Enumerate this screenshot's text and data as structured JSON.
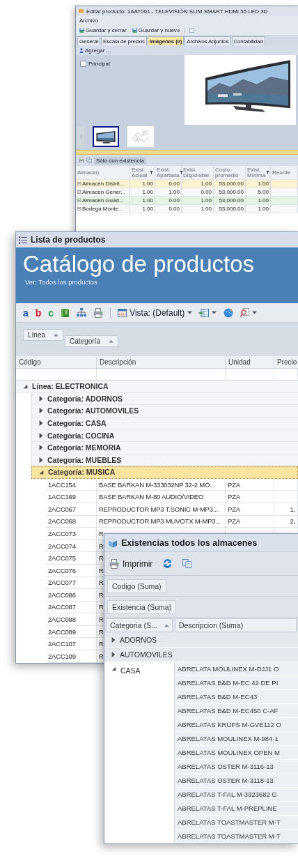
{
  "editor_window": {
    "title": "Editar producto: 1AAT001 - TELEVISIÓN SLIM SMART HDMI 55 LED 3D",
    "menu": [
      "Archivo"
    ],
    "toolbar": [
      "Guardar y cerrar",
      "Guardar y nuevo"
    ],
    "tabs": [
      {
        "label": "General",
        "selected": false
      },
      {
        "label": "Escala de precios",
        "selected": false
      },
      {
        "label": "Imágenes (2)",
        "selected": true
      },
      {
        "label": "Archivos Adjuntos",
        "selected": false
      },
      {
        "label": "Contabilidad",
        "selected": false
      }
    ],
    "add_button": "Agregar ...",
    "principal_checkbox": {
      "label": "Principal",
      "checked": false
    },
    "image": {
      "kind": "picture"
    },
    "thumbnails": [
      {
        "selected": true
      },
      {
        "selected": false
      }
    ],
    "stock_grid": {
      "toggle": {
        "label": "Sólo con existencia",
        "on": true
      },
      "columns": [
        {
          "label": "Almacén",
          "filter": false
        },
        {
          "label": "Exist. Actual",
          "filter": true
        },
        {
          "label": "Exist. Apartada",
          "filter": true
        },
        {
          "label": "Exist. Disponible",
          "filter": false
        },
        {
          "label": "Costo promedio",
          "filter": false
        },
        {
          "label": "Exist. Mínima",
          "filter": true
        },
        {
          "label": "Reorde",
          "filter": false
        }
      ],
      "rows": [
        {
          "cells": [
            "Almacén Distrit...",
            "1.00",
            "0.00",
            "1.00",
            "53,000.00",
            "1.00"
          ],
          "selected": true,
          "highlighted": false
        },
        {
          "cells": [
            "Almacen Gener...",
            "1.00",
            "1.00",
            "0.00",
            "53,000.00",
            "5.00"
          ],
          "selected": false,
          "highlighted": false
        },
        {
          "cells": [
            "Almacen Guad...",
            "1.00",
            "0.00",
            "1.00",
            "53,000.00",
            "1.00"
          ],
          "selected": false,
          "highlighted": true
        },
        {
          "cells": [
            "Bodega Monte...",
            "1.00",
            "0.00",
            "1.00",
            "53,000.00",
            "1.00"
          ],
          "selected": false,
          "highlighted": false
        }
      ]
    }
  },
  "catalog_window": {
    "title": "Lista de productos",
    "heading": "Catálogo de productos",
    "subheading": "Ver: Todos los productos",
    "toolbar": {
      "letters": [
        {
          "label": "a",
          "color": "#1f4fa8"
        },
        {
          "label": "b",
          "color": "#c8202a"
        },
        {
          "label": "c",
          "color": "#2a9a3a"
        }
      ],
      "view_label": "Vista: (Default)"
    },
    "group_by": [
      "Línea",
      "Categoría"
    ],
    "columns": [
      "Código",
      "Descripción",
      "Unidad",
      "Precio"
    ],
    "tree": [
      {
        "label": "Línea: ELECTRONICA",
        "expanded": true,
        "selected": false,
        "children": [
          {
            "label": "Categoría: ADORNOS",
            "expanded": false,
            "selected": false
          },
          {
            "label": "Categoría: AUTOMOVILES",
            "expanded": false,
            "selected": false
          },
          {
            "label": "Categoría: CASA",
            "expanded": false,
            "selected": false
          },
          {
            "label": "Categoría: COCINA",
            "expanded": false,
            "selected": false
          },
          {
            "label": "Categoría: MEMORIA",
            "expanded": false,
            "selected": false
          },
          {
            "label": "Categoría: MUEBLES",
            "expanded": false,
            "selected": false
          },
          {
            "label": "Categoría: MUSICA",
            "expanded": true,
            "selected": true,
            "rows": [
              {
                "cells": [
                  "1ACC154",
                  "BASE BARKAN M-333032NP 32-2 MO...",
                  "PZA"
                ]
              },
              {
                "cells": [
                  "1ACC169",
                  "BASE BARKAN M-80 AUDIO/VIDEO",
                  "PZA"
                ]
              },
              {
                "cells": [
                  "2ACC067",
                  "REPRODUCTOR MP3 T.SONIC M-MP3...",
                  "PZA",
                  "1,"
                ]
              },
              {
                "cells": [
                  "2ACC068",
                  "REPRODUCTOR MP3 MUVOTX M-MP3...",
                  "PZA",
                  "2,"
                ]
              },
              {
                "cells": [
                  "2ACC073",
                  "R"
                ]
              },
              {
                "cells": [
                  "2ACC074",
                  "R"
                ]
              },
              {
                "cells": [
                  "2ACC075",
                  "R"
                ]
              },
              {
                "cells": [
                  "2ACC076",
                  "R"
                ]
              },
              {
                "cells": [
                  "2ACC077",
                  "R"
                ]
              },
              {
                "cells": [
                  "2ACC086",
                  "R"
                ]
              },
              {
                "cells": [
                  "2ACC087",
                  "R"
                ]
              },
              {
                "cells": [
                  "2ACC088",
                  "R"
                ]
              },
              {
                "cells": [
                  "2ACC089",
                  "R"
                ]
              },
              {
                "cells": [
                  "2ACC107",
                  "R"
                ]
              },
              {
                "cells": [
                  "2ACC109",
                  "R"
                ]
              }
            ]
          }
        ]
      }
    ]
  },
  "stock_window": {
    "title": "Existencias todos los almacenes",
    "print_button": "Imprimir",
    "filter_fields": [
      "Codigo (Suma)",
      "Existencia (Suma)"
    ],
    "columns": [
      {
        "label": "Categoria (S...",
        "sorted": true
      },
      {
        "label": "Descripcion (Suma)",
        "sorted": false
      }
    ],
    "groups": [
      {
        "label": "ADORNOS",
        "expanded": false
      },
      {
        "label": "AUTOMOVILES",
        "expanded": false
      },
      {
        "label": "CASA",
        "expanded": true,
        "items": [
          "ABRELATA MOULINEX M-DJJ1 O",
          "ABRELATAS B&D M-EC 42 DE PI",
          "ABRELATAS B&D M-EC43",
          "ABRELATAS B&D M-EC450 C-AF",
          "ABRELATAS KRUPS M-GVE112 O",
          "ABRELATAS MOULINEX M-984-1",
          "ABRELATAS MOULINEX OPEN M",
          "ABRELATAS OSTER M-3116-13",
          "ABRELATAS OSTER M-3118-13",
          "ABRELATAS T-FAL M-3323682 G",
          "ABRELATAS T-FAL M-PREPLINE",
          "ABRELATAS TOASTMASTER M-T",
          "ABRELATAS TOASTMASTER M-T"
        ]
      }
    ]
  }
}
